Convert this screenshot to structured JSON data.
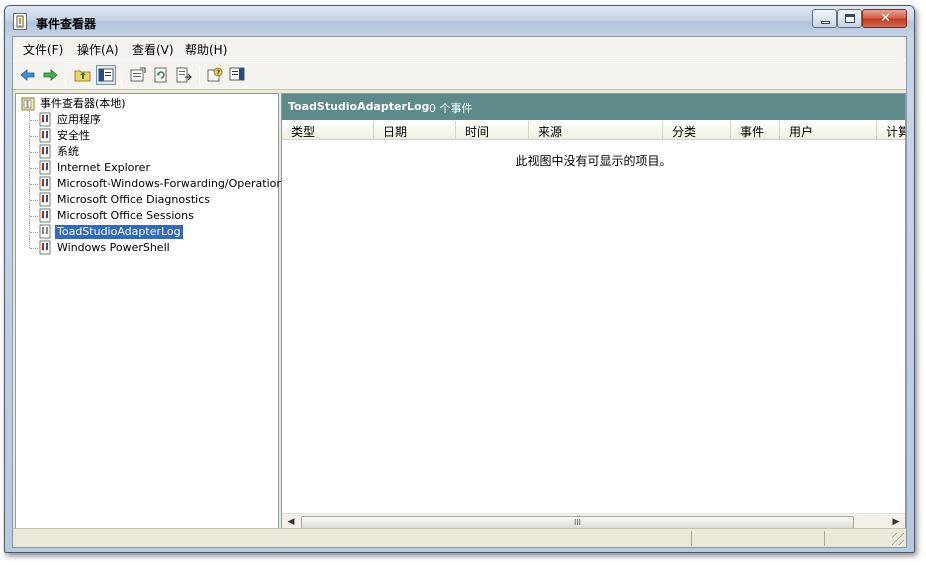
{
  "window": {
    "title": "事件查看器"
  },
  "menu": [
    "文件(F)",
    "操作(A)",
    "查看(V)",
    "帮助(H)"
  ],
  "toolbar_icons": [
    "back-icon",
    "forward-icon",
    "up-folder-icon",
    "show-hide-tree-icon",
    "properties-icon",
    "refresh-icon",
    "export-list-icon",
    "help-icon",
    "show-hide-action-pane-icon"
  ],
  "tree": {
    "root": "事件查看器(本地)",
    "items": [
      "应用程序",
      "安全性",
      "系统",
      "Internet Explorer",
      "Microsoft-Windows-Forwarding/Operational",
      "Microsoft Office Diagnostics",
      "Microsoft Office Sessions",
      "ToadStudioAdapterLog",
      "Windows PowerShell"
    ],
    "selected": "ToadStudioAdapterLog"
  },
  "list": {
    "header_title": "ToadStudioAdapterLog",
    "header_count": "0 个事件",
    "columns": [
      "类型",
      "日期",
      "时间",
      "来源",
      "分类",
      "事件",
      "用户",
      "计算机"
    ],
    "empty_message": "此视图中没有可显示的项目。"
  },
  "scrollbar": {
    "grip": "III"
  },
  "colors": {
    "header_bg": "#5e8a8c",
    "selection": "#316ac5",
    "menubar": "#f4f3ee"
  }
}
